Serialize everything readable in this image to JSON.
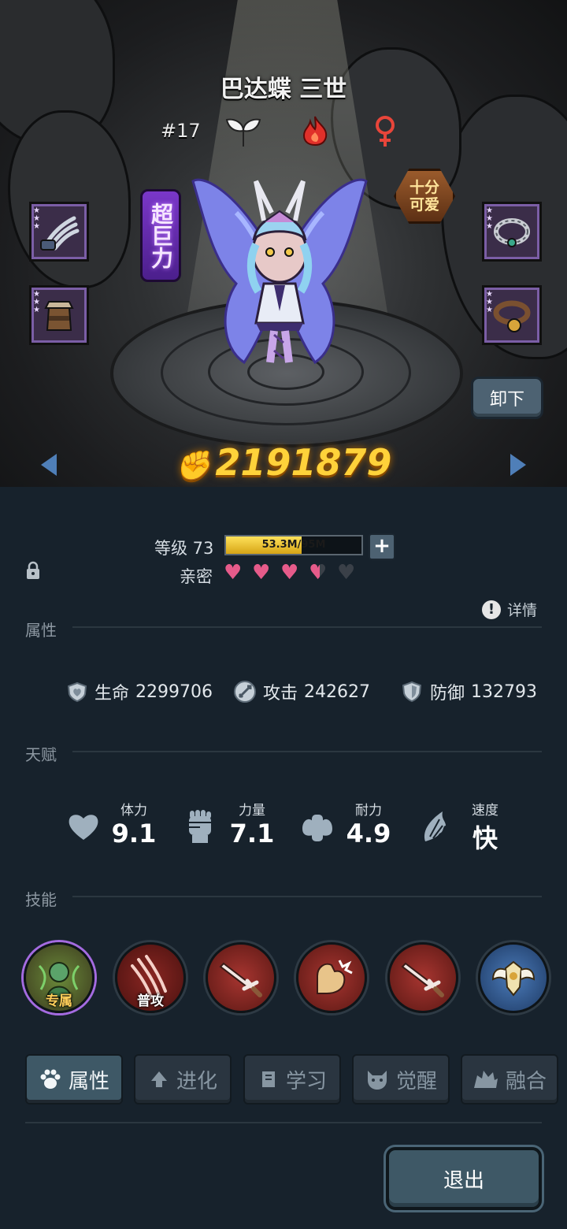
{
  "hero": {
    "name": "巴达蝶 三世",
    "rank": "#17",
    "element_icons": [
      "leaf-icon",
      "fire-icon",
      "female-icon"
    ],
    "trait_vertical": "超巨力",
    "trait_hex": "十分可爱",
    "unload_label": "卸下",
    "power": "2191879"
  },
  "equipment": {
    "left": [
      "claw-weapon-icon",
      "helmet-icon"
    ],
    "right": [
      "chain-collar-icon",
      "bell-collar-icon"
    ]
  },
  "level": {
    "label": "等级 73",
    "xp_text": "53.3M/95M",
    "xp_progress": 0.56,
    "intimacy_label": "亲密",
    "hearts": [
      "full",
      "full",
      "full",
      "half",
      "empty"
    ]
  },
  "sections": {
    "attributes": "属性",
    "details": "详情",
    "talent": "天赋",
    "skills": "技能"
  },
  "stats": [
    {
      "icon": "heart-shield-icon",
      "label": "生命",
      "value": "2299706"
    },
    {
      "icon": "sword-icon",
      "label": "攻击",
      "value": "242627"
    },
    {
      "icon": "shield-icon",
      "label": "防御",
      "value": "132793"
    }
  ],
  "talents": [
    {
      "icon": "heart-icon",
      "label": "体力",
      "value": "9.1"
    },
    {
      "icon": "fist-icon",
      "label": "力量",
      "value": "7.1"
    },
    {
      "icon": "muscle-icon",
      "label": "耐力",
      "value": "4.9"
    },
    {
      "icon": "wing-icon",
      "label": "速度",
      "value": "快"
    }
  ],
  "skills": [
    {
      "icon": "exclusive-skill-icon",
      "tag": "专属"
    },
    {
      "icon": "claw-slash-icon",
      "tag": "普攻"
    },
    {
      "icon": "sword-skill-icon",
      "tag": ""
    },
    {
      "icon": "flex-arm-icon",
      "tag": ""
    },
    {
      "icon": "sword-skill-icon",
      "tag": ""
    },
    {
      "icon": "angel-emblem-icon",
      "tag": ""
    }
  ],
  "tabs": [
    {
      "icon": "paw-icon",
      "label": "属性",
      "active": true
    },
    {
      "icon": "evolve-arrow-icon",
      "label": "进化",
      "active": false
    },
    {
      "icon": "book-icon",
      "label": "学习",
      "active": false
    },
    {
      "icon": "beast-head-icon",
      "label": "觉醒",
      "active": false
    },
    {
      "icon": "fusion-icon",
      "label": "融合",
      "active": false
    }
  ],
  "quit_label": "退出",
  "colors": {
    "power": "#ffd23a",
    "heart": "#e65b8a",
    "xp_fill": "#e0b520",
    "panel_bg": "#17222c",
    "tab_active": "#3e5866"
  }
}
